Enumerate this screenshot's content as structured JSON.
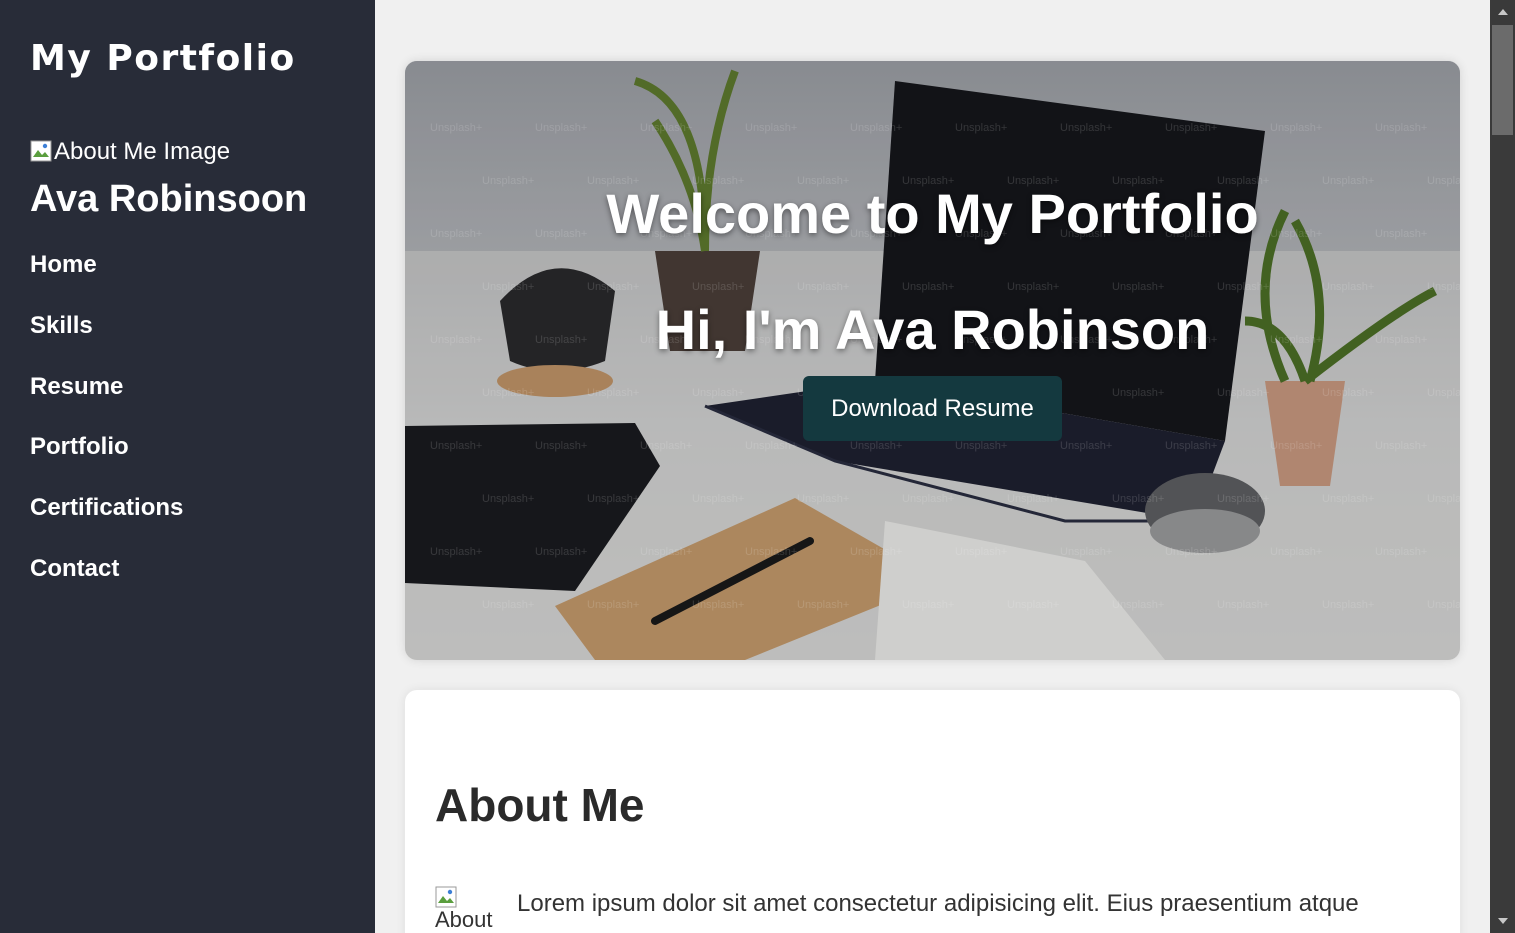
{
  "sidebar": {
    "brand": "My Portfolio",
    "profile_image_alt": "About Me Image",
    "name": "Ava Robinsoon",
    "nav": [
      {
        "label": "Home"
      },
      {
        "label": "Skills"
      },
      {
        "label": "Resume"
      },
      {
        "label": "Portfolio"
      },
      {
        "label": "Certifications"
      },
      {
        "label": "Contact"
      }
    ]
  },
  "hero": {
    "title": "Welcome to My Portfolio",
    "subtitle": "Hi, I'm Ava Robinson",
    "button_label": "Download Resume",
    "watermark": "Unsplash+"
  },
  "about": {
    "title": "About Me",
    "image_alt": "About",
    "text": "Lorem ipsum dolor sit amet consectetur adipisicing elit. Eius praesentium atque"
  },
  "colors": {
    "sidebar_bg": "#282c38",
    "page_bg": "#f0f0f0",
    "button_bg": "#14393f"
  }
}
